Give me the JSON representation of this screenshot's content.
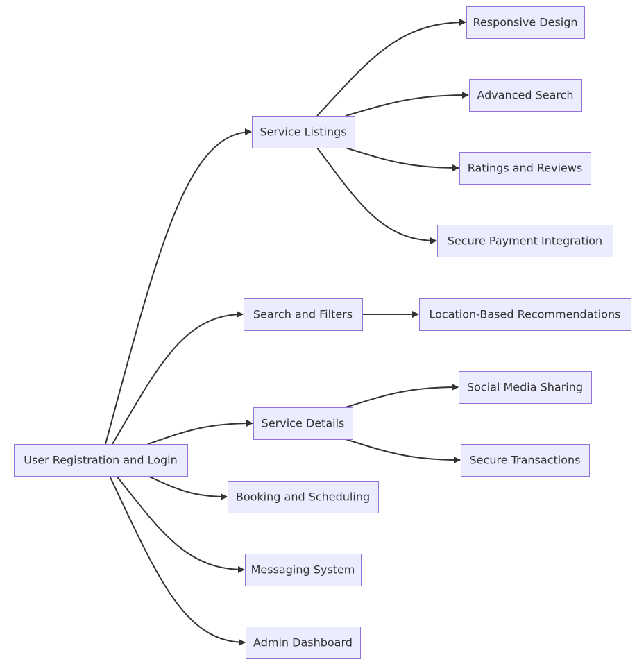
{
  "diagram": {
    "type": "flowchart",
    "direction": "left-to-right",
    "colors": {
      "node_fill": "#ECECFF",
      "node_border": "#9370DB",
      "edge": "#333333",
      "text": "#333333"
    },
    "nodes": [
      {
        "id": "root",
        "label": "User Registration and Login"
      },
      {
        "id": "listings",
        "label": "Service Listings"
      },
      {
        "id": "search",
        "label": "Search and Filters"
      },
      {
        "id": "details",
        "label": "Service Details"
      },
      {
        "id": "booking",
        "label": "Booking and Scheduling"
      },
      {
        "id": "messaging",
        "label": "Messaging System"
      },
      {
        "id": "admin",
        "label": "Admin Dashboard"
      },
      {
        "id": "responsive",
        "label": "Responsive Design"
      },
      {
        "id": "advsearch",
        "label": "Advanced Search"
      },
      {
        "id": "ratings",
        "label": "Ratings and Reviews"
      },
      {
        "id": "payment",
        "label": "Secure Payment Integration"
      },
      {
        "id": "location",
        "label": "Location-Based Recommendations"
      },
      {
        "id": "social",
        "label": "Social Media Sharing"
      },
      {
        "id": "transactions",
        "label": "Secure Transactions"
      }
    ],
    "edges": [
      {
        "from": "root",
        "to": "listings"
      },
      {
        "from": "root",
        "to": "search"
      },
      {
        "from": "root",
        "to": "details"
      },
      {
        "from": "root",
        "to": "booking"
      },
      {
        "from": "root",
        "to": "messaging"
      },
      {
        "from": "root",
        "to": "admin"
      },
      {
        "from": "listings",
        "to": "responsive"
      },
      {
        "from": "listings",
        "to": "advsearch"
      },
      {
        "from": "listings",
        "to": "ratings"
      },
      {
        "from": "listings",
        "to": "payment"
      },
      {
        "from": "search",
        "to": "location"
      },
      {
        "from": "details",
        "to": "social"
      },
      {
        "from": "details",
        "to": "transactions"
      }
    ]
  }
}
